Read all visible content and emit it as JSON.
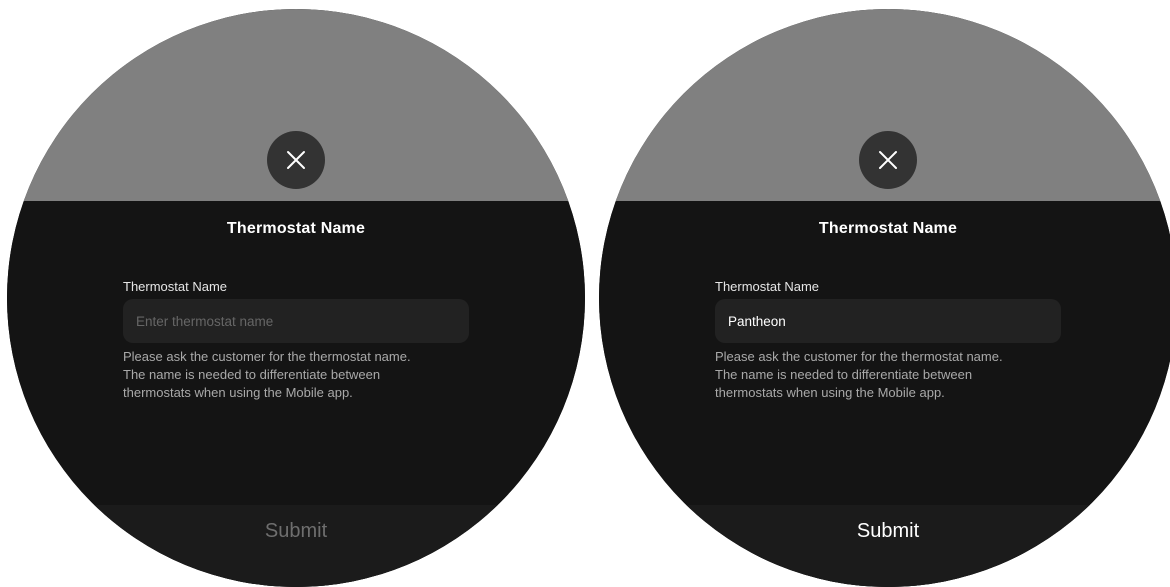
{
  "screens": [
    {
      "state": "empty",
      "close_icon": "close-icon",
      "title": "Thermostat Name",
      "field_label": "Thermostat Name",
      "field_value": "",
      "field_placeholder": "Enter thermostat name",
      "helper_lines": [
        "Please ask the customer for the thermostat name.",
        "The name is needed to differentiate between",
        "thermostats when using the Mobile app."
      ],
      "submit_label": "Submit",
      "submit_enabled": false
    },
    {
      "state": "filled",
      "close_icon": "close-icon",
      "title": "Thermostat Name",
      "field_label": "Thermostat Name",
      "field_value": "Pantheon",
      "field_placeholder": "Enter thermostat name",
      "helper_lines": [
        "Please ask the customer for the thermostat name.",
        "The name is needed to differentiate between",
        "thermostats when using the Mobile app."
      ],
      "submit_label": "Submit",
      "submit_enabled": true
    }
  ],
  "colors": {
    "backdrop": "#808080",
    "sheet": "#141414",
    "close_button": "#333333",
    "input_bg": "#222222",
    "submit_bar": "#1b1b1b",
    "submit_disabled_text": "#6e6e6e",
    "submit_enabled_text": "#ffffff"
  }
}
